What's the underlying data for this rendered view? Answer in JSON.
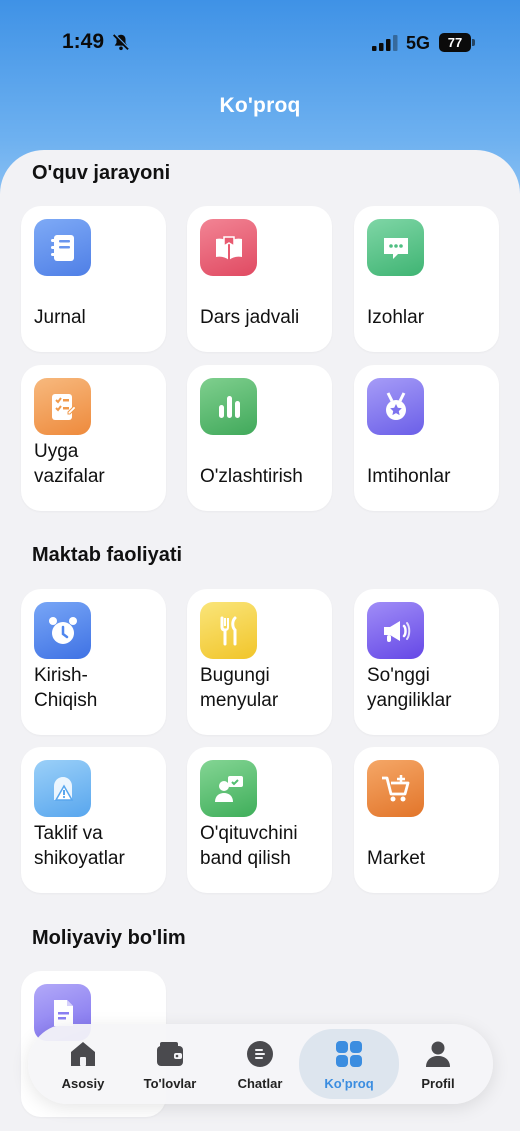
{
  "status_bar": {
    "time": "1:49",
    "network": "5G",
    "battery": "77"
  },
  "header": {
    "title": "Ko'proq"
  },
  "sections": [
    {
      "title": "O'quv jarayoni",
      "items": [
        {
          "label": "Jurnal",
          "icon": "journal-icon",
          "color": "#5b8ff0"
        },
        {
          "label": "Dars jadvali",
          "icon": "book-icon",
          "color": "#e4566b"
        },
        {
          "label": "Izohlar",
          "icon": "comment-icon",
          "color": "#4fbf82"
        },
        {
          "label": "Uyga vazifalar",
          "icon": "homework-icon",
          "color": "#f09a4c"
        },
        {
          "label": "O'zlashtirish",
          "icon": "bar-chart-icon",
          "color": "#56b86b"
        },
        {
          "label": "Imtihonlar",
          "icon": "medal-icon",
          "color": "#7e73ee"
        }
      ]
    },
    {
      "title": "Maktab faoliyati",
      "items": [
        {
          "label": "Kirish-Chiqish",
          "icon": "alarm-clock-icon",
          "color": "#4f86ee"
        },
        {
          "label": "Bugungi menyular",
          "icon": "fork-knife-icon",
          "color": "#f4cf3a"
        },
        {
          "label": "So'nggi yangiliklar",
          "icon": "megaphone-icon",
          "color": "#7a63ee"
        },
        {
          "label": "Taklif va shikoyatlar",
          "icon": "warning-icon",
          "color": "#6ab4f2"
        },
        {
          "label": "O'qituvchini band qilish",
          "icon": "teacher-icon",
          "color": "#52bf70"
        },
        {
          "label": "Market",
          "icon": "cart-icon",
          "color": "#ee8a3e"
        }
      ]
    },
    {
      "title": "Moliyaviy bo'lim",
      "items": [
        {
          "label": "",
          "icon": "document-icon",
          "color": "#8a7ff2"
        }
      ]
    }
  ],
  "tabbar": {
    "items": [
      {
        "label": "Asosiy",
        "icon": "home-icon",
        "active": false
      },
      {
        "label": "To'lovlar",
        "icon": "wallet-icon",
        "active": false
      },
      {
        "label": "Chatlar",
        "icon": "chat-icon",
        "active": false
      },
      {
        "label": "Ko'proq",
        "icon": "grid-icon",
        "active": true
      },
      {
        "label": "Profil",
        "icon": "user-icon",
        "active": false
      }
    ],
    "accent": "#3b8de0"
  }
}
